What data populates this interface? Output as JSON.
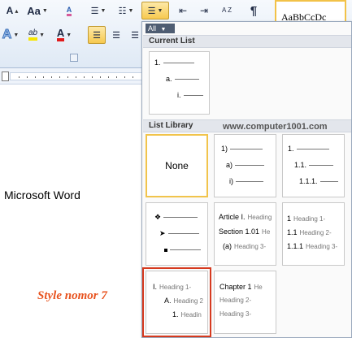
{
  "ribbon": {
    "font_size_up": "A",
    "change_case": "Aa",
    "clear_format": "A",
    "text_effects": "A",
    "highlight": "ab",
    "font_color": "A",
    "show_marks": "¶",
    "sort": "A Z",
    "style_preview": "AaBbCcDc",
    "colors": {
      "accent_active": "#f7c94f",
      "highlight_bar": "#f7e600",
      "font_color_bar": "#e11b1b"
    }
  },
  "gallery": {
    "filter_label": "All",
    "current_section": "Current List",
    "library_section": "List Library",
    "watermark": "www.computer1001.com",
    "current_tile": [
      "1.",
      "a.",
      "i."
    ],
    "none_label": "None",
    "tiles": {
      "numbered_paren": [
        "1)",
        "a)",
        "i)"
      ],
      "legal_decimal": [
        "1.",
        "1.1.",
        "1.1.1."
      ],
      "article": {
        "l1": "Article I.",
        "l1_hd": "Heading",
        "l2": "Section 1.01",
        "l2_hd": "He",
        "l3": "(a)",
        "l3_hd": "Heading 3-"
      },
      "heading_decimal": {
        "l1": "1",
        "l1_hd": "Heading 1-",
        "l2": "1.1",
        "l2_hd": "Heading 2-",
        "l3": "1.1.1",
        "l3_hd": "Heading 3-"
      },
      "style7": {
        "l1": "I.",
        "l1_hd": "Heading 1-",
        "l2": "A.",
        "l2_hd": "Heading 2",
        "l3": "1.",
        "l3_hd": "Headin"
      },
      "chapter": {
        "l1": "Chapter 1",
        "l1_hd": "He",
        "l2_hd": "Heading 2-",
        "l3_hd": "Heading 3-"
      }
    }
  },
  "document": {
    "text": "Microsoft Word",
    "annotation": "Style nomor 7"
  }
}
